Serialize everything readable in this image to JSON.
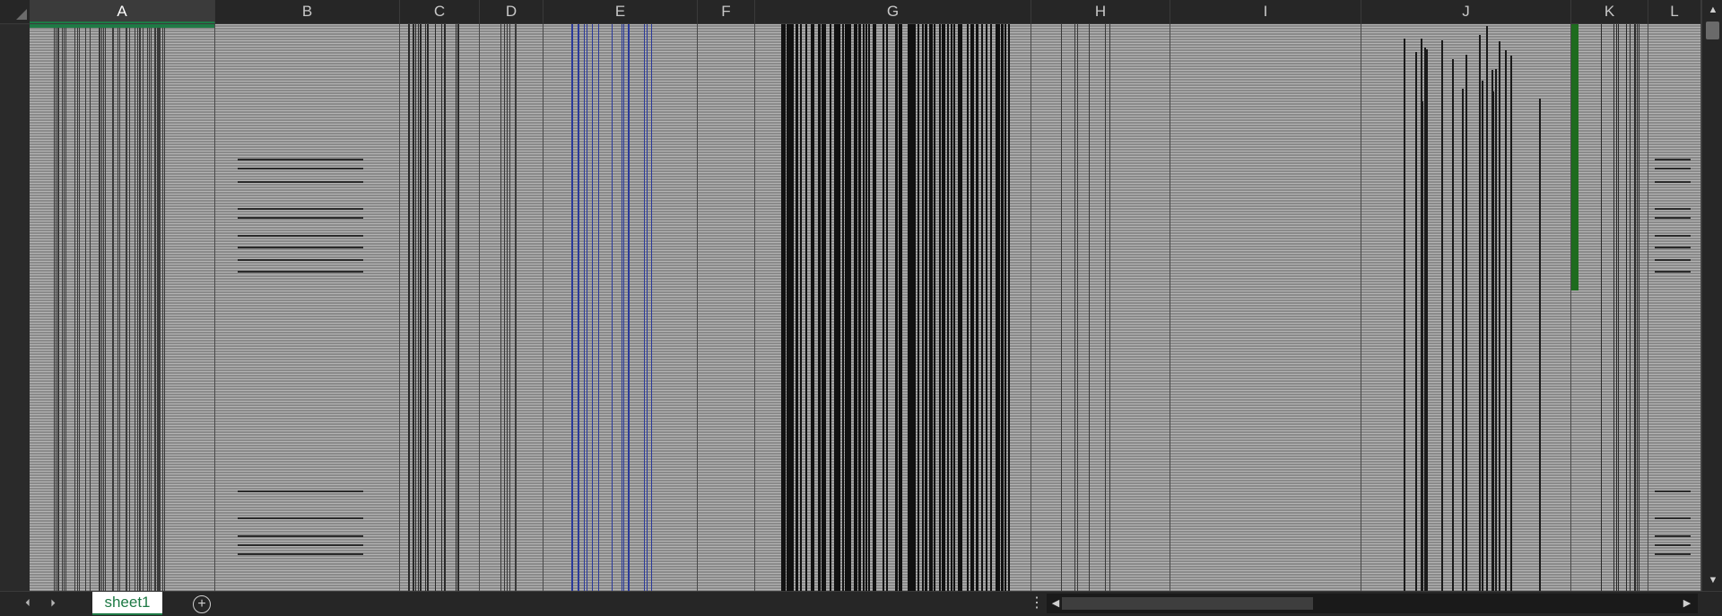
{
  "app": {
    "active_cell_column": "A",
    "accent_color": "#1e7a45"
  },
  "columns": [
    {
      "letter": "A",
      "pattern": "dense-dark",
      "color": "#3a3a3a"
    },
    {
      "letter": "B",
      "pattern": "sparse-text",
      "color": "#3a3a3a"
    },
    {
      "letter": "C",
      "pattern": "dense-dark",
      "color": "#2a2a2a"
    },
    {
      "letter": "D",
      "pattern": "narrow-text",
      "color": "#3a3a3a"
    },
    {
      "letter": "E",
      "pattern": "blue-lines",
      "color": "#2b3a9b"
    },
    {
      "letter": "F",
      "pattern": "empty",
      "color": "#3a3a3a"
    },
    {
      "letter": "G",
      "pattern": "dense-black",
      "color": "#111111"
    },
    {
      "letter": "H",
      "pattern": "sparse-dark",
      "color": "#3a3a3a"
    },
    {
      "letter": "I",
      "pattern": "empty",
      "color": "#3a3a3a"
    },
    {
      "letter": "J",
      "pattern": "mixed-dark",
      "color": "#1a1a1a"
    },
    {
      "letter": "K",
      "pattern": "green-bar",
      "color": "#1e6b1e"
    },
    {
      "letter": "L",
      "pattern": "sparse-text",
      "color": "#3a3a3a"
    }
  ],
  "sheets": [
    {
      "label": "sheet1",
      "active": true
    }
  ],
  "icons": {
    "select_all": "triangle-corner-icon",
    "scroll_up": "chevron-up-icon",
    "scroll_down": "chevron-down-icon",
    "scroll_left": "chevron-left-icon",
    "scroll_right": "chevron-right-icon",
    "prev_sheet": "chevron-left-icon",
    "next_sheet": "chevron-right-icon",
    "add_sheet": "plus-circle-icon",
    "split": "vertical-ellipsis-icon"
  },
  "glyphs": {
    "up": "▲",
    "down": "▼",
    "left": "◀",
    "right": "▶",
    "nav_left": "⏴",
    "nav_right": "⏵",
    "plus": "+",
    "dots": "⋮"
  }
}
